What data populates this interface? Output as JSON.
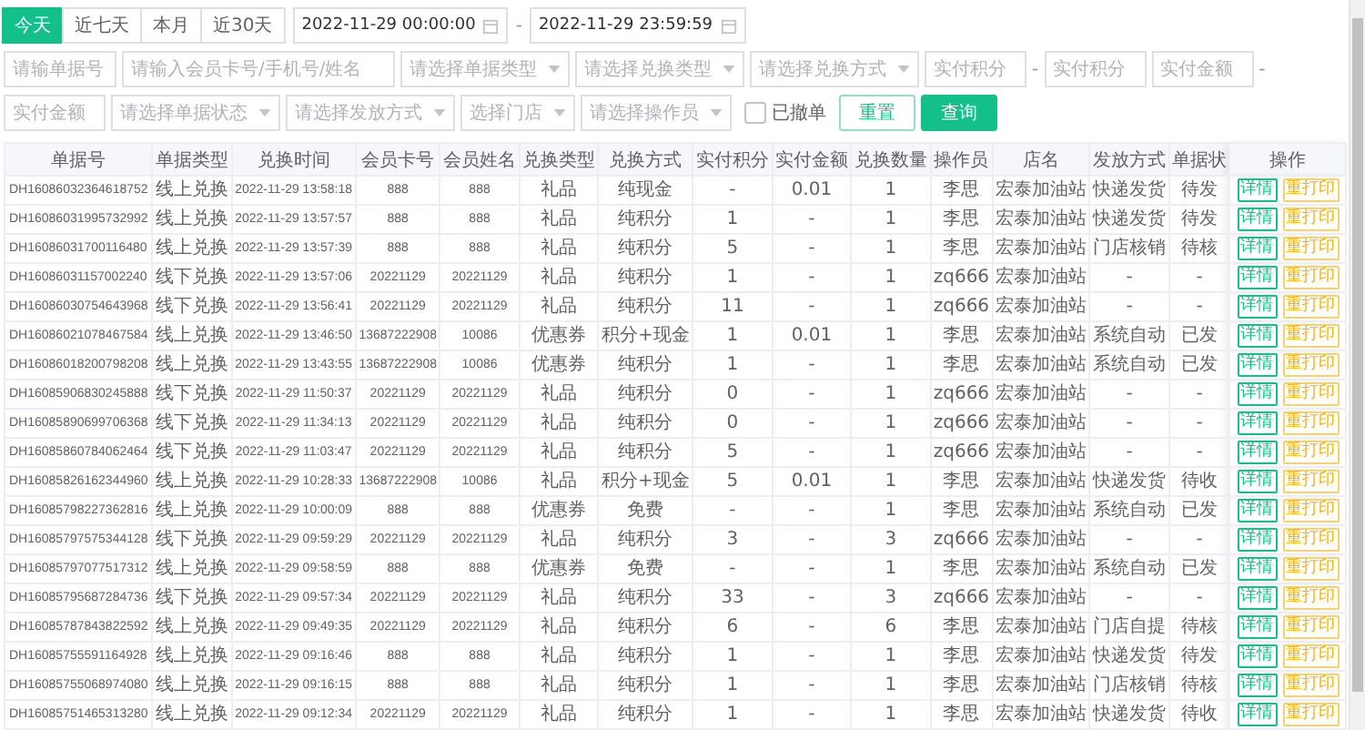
{
  "quick_ranges": [
    {
      "label": "今天",
      "selected": true
    },
    {
      "label": "近七天",
      "selected": false
    },
    {
      "label": "本月",
      "selected": false
    },
    {
      "label": "近30天",
      "selected": false
    }
  ],
  "date_range": {
    "start": "2022-11-29 00:00:00",
    "separator": "-",
    "end": "2022-11-29 23:59:59"
  },
  "filters": [
    {
      "kind": "input",
      "placeholder": "请输单据号"
    },
    {
      "kind": "input",
      "placeholder": "请输入会员卡号/手机号/姓名"
    },
    {
      "kind": "select",
      "placeholder": "请选择单据类型"
    },
    {
      "kind": "select",
      "placeholder": "请选择兑换类型"
    },
    {
      "kind": "select",
      "placeholder": "请选择兑换方式"
    },
    {
      "kind": "input",
      "placeholder": "实付积分"
    },
    {
      "kind": "dash",
      "text": "-"
    },
    {
      "kind": "input",
      "placeholder": "实付积分"
    },
    {
      "kind": "input",
      "placeholder": "实付金额"
    },
    {
      "kind": "dash",
      "text": "-"
    },
    {
      "kind": "input",
      "placeholder": "实付金额"
    },
    {
      "kind": "select",
      "placeholder": "请选择单据状态"
    },
    {
      "kind": "select",
      "placeholder": "请选择发放方式"
    },
    {
      "kind": "select",
      "placeholder": "选择门店"
    },
    {
      "kind": "select",
      "placeholder": "请选择操作员"
    },
    {
      "kind": "checkbox",
      "label": "已撤单",
      "checked": false
    },
    {
      "kind": "outline_button",
      "label": "重置"
    },
    {
      "kind": "primary_button",
      "label": "查询"
    }
  ],
  "table": {
    "columns": [
      {
        "label": "单据号",
        "kind": "code"
      },
      {
        "label": "单据类型",
        "kind": "text"
      },
      {
        "label": "兑换时间",
        "kind": "code"
      },
      {
        "label": "会员卡号",
        "kind": "code"
      },
      {
        "label": "会员姓名",
        "kind": "code"
      },
      {
        "label": "兑换类型",
        "kind": "text"
      },
      {
        "label": "兑换方式",
        "kind": "text"
      },
      {
        "label": "实付积分",
        "kind": "text"
      },
      {
        "label": "实付金额",
        "kind": "text"
      },
      {
        "label": "兑换数量",
        "kind": "text"
      },
      {
        "label": "操作员",
        "kind": "text"
      },
      {
        "label": "店名",
        "kind": "text"
      },
      {
        "label": "发放方式",
        "kind": "text"
      },
      {
        "label": "单据状",
        "kind": "cut"
      },
      {
        "label": "操作",
        "kind": "actions"
      }
    ],
    "rows": [
      {
        "cells": [
          "DH16086032364618752",
          "线上兑换",
          "2022-11-29 13:58:18",
          "888",
          "888",
          "礼品",
          "纯现金",
          "-",
          "0.01",
          "1",
          "李思",
          "宏泰加油站",
          "快递发货",
          "待发"
        ],
        "actions": [
          {
            "label": "详情",
            "kind": "detail"
          },
          {
            "label": "重打印",
            "kind": "reprint"
          }
        ]
      },
      {
        "cells": [
          "DH16086031995732992",
          "线上兑换",
          "2022-11-29 13:57:57",
          "888",
          "888",
          "礼品",
          "纯积分",
          "1",
          "-",
          "1",
          "李思",
          "宏泰加油站",
          "快递发货",
          "待发"
        ],
        "actions": [
          {
            "label": "详情",
            "kind": "detail"
          },
          {
            "label": "重打印",
            "kind": "reprint"
          }
        ]
      },
      {
        "cells": [
          "DH16086031700116480",
          "线上兑换",
          "2022-11-29 13:57:39",
          "888",
          "888",
          "礼品",
          "纯积分",
          "5",
          "-",
          "1",
          "李思",
          "宏泰加油站",
          "门店核销",
          "待核"
        ],
        "actions": [
          {
            "label": "详情",
            "kind": "detail"
          },
          {
            "label": "重打印",
            "kind": "reprint"
          }
        ]
      },
      {
        "cells": [
          "DH16086031157002240",
          "线下兑换",
          "2022-11-29 13:57:06",
          "20221129",
          "20221129",
          "礼品",
          "纯积分",
          "1",
          "-",
          "1",
          "zq666",
          "宏泰加油站",
          "-",
          "-"
        ],
        "actions": [
          {
            "label": "详情",
            "kind": "detail"
          },
          {
            "label": "重打印",
            "kind": "reprint"
          }
        ]
      },
      {
        "cells": [
          "DH16086030754643968",
          "线下兑换",
          "2022-11-29 13:56:41",
          "20221129",
          "20221129",
          "礼品",
          "纯积分",
          "11",
          "-",
          "1",
          "zq666",
          "宏泰加油站",
          "-",
          "-"
        ],
        "actions": [
          {
            "label": "详情",
            "kind": "detail"
          },
          {
            "label": "重打印",
            "kind": "reprint"
          }
        ]
      },
      {
        "cells": [
          "DH16086021078467584",
          "线上兑换",
          "2022-11-29 13:46:50",
          "13687222908",
          "10086",
          "优惠券",
          "积分+现金",
          "1",
          "0.01",
          "1",
          "李思",
          "宏泰加油站",
          "系统自动",
          "已发"
        ],
        "actions": [
          {
            "label": "详情",
            "kind": "detail"
          },
          {
            "label": "重打印",
            "kind": "reprint"
          }
        ]
      },
      {
        "cells": [
          "DH16086018200798208",
          "线上兑换",
          "2022-11-29 13:43:55",
          "13687222908",
          "10086",
          "优惠券",
          "纯积分",
          "1",
          "-",
          "1",
          "李思",
          "宏泰加油站",
          "系统自动",
          "已发"
        ],
        "actions": [
          {
            "label": "详情",
            "kind": "detail"
          },
          {
            "label": "重打印",
            "kind": "reprint"
          }
        ]
      },
      {
        "cells": [
          "DH16085906830245888",
          "线下兑换",
          "2022-11-29 11:50:37",
          "20221129",
          "20221129",
          "礼品",
          "纯积分",
          "0",
          "-",
          "1",
          "zq666",
          "宏泰加油站",
          "-",
          "-"
        ],
        "actions": [
          {
            "label": "详情",
            "kind": "detail"
          },
          {
            "label": "重打印",
            "kind": "reprint"
          }
        ]
      },
      {
        "cells": [
          "DH16085890699706368",
          "线下兑换",
          "2022-11-29 11:34:13",
          "20221129",
          "20221129",
          "礼品",
          "纯积分",
          "0",
          "-",
          "1",
          "zq666",
          "宏泰加油站",
          "-",
          "-"
        ],
        "actions": [
          {
            "label": "详情",
            "kind": "detail"
          },
          {
            "label": "重打印",
            "kind": "reprint"
          }
        ]
      },
      {
        "cells": [
          "DH16085860784062464",
          "线下兑换",
          "2022-11-29 11:03:47",
          "20221129",
          "20221129",
          "礼品",
          "纯积分",
          "5",
          "-",
          "1",
          "zq666",
          "宏泰加油站",
          "-",
          "-"
        ],
        "actions": [
          {
            "label": "详情",
            "kind": "detail"
          },
          {
            "label": "重打印",
            "kind": "reprint"
          }
        ]
      },
      {
        "cells": [
          "DH16085826162344960",
          "线上兑换",
          "2022-11-29 10:28:33",
          "13687222908",
          "10086",
          "礼品",
          "积分+现金",
          "5",
          "0.01",
          "1",
          "李思",
          "宏泰加油站",
          "快递发货",
          "待收"
        ],
        "actions": [
          {
            "label": "详情",
            "kind": "detail"
          },
          {
            "label": "重打印",
            "kind": "reprint"
          }
        ]
      },
      {
        "cells": [
          "DH16085798227362816",
          "线上兑换",
          "2022-11-29 10:00:09",
          "888",
          "888",
          "优惠券",
          "免费",
          "-",
          "-",
          "1",
          "李思",
          "宏泰加油站",
          "系统自动",
          "已发"
        ],
        "actions": [
          {
            "label": "详情",
            "kind": "detail"
          },
          {
            "label": "重打印",
            "kind": "reprint"
          }
        ]
      },
      {
        "cells": [
          "DH16085797575344128",
          "线下兑换",
          "2022-11-29 09:59:29",
          "20221129",
          "20221129",
          "礼品",
          "纯积分",
          "3",
          "-",
          "3",
          "zq666",
          "宏泰加油站",
          "-",
          "-"
        ],
        "actions": [
          {
            "label": "详情",
            "kind": "detail"
          },
          {
            "label": "重打印",
            "kind": "reprint"
          }
        ]
      },
      {
        "cells": [
          "DH16085797077517312",
          "线上兑换",
          "2022-11-29 09:58:59",
          "888",
          "888",
          "优惠券",
          "免费",
          "-",
          "-",
          "1",
          "李思",
          "宏泰加油站",
          "系统自动",
          "已发"
        ],
        "actions": [
          {
            "label": "详情",
            "kind": "detail"
          },
          {
            "label": "重打印",
            "kind": "reprint"
          }
        ]
      },
      {
        "cells": [
          "DH16085795687284736",
          "线下兑换",
          "2022-11-29 09:57:34",
          "20221129",
          "20221129",
          "礼品",
          "纯积分",
          "33",
          "-",
          "3",
          "zq666",
          "宏泰加油站",
          "-",
          "-"
        ],
        "actions": [
          {
            "label": "详情",
            "kind": "detail"
          },
          {
            "label": "重打印",
            "kind": "reprint"
          }
        ]
      },
      {
        "cells": [
          "DH16085787843822592",
          "线上兑换",
          "2022-11-29 09:49:35",
          "20221129",
          "20221129",
          "礼品",
          "纯积分",
          "6",
          "-",
          "6",
          "李思",
          "宏泰加油站",
          "门店自提",
          "待核"
        ],
        "actions": [
          {
            "label": "详情",
            "kind": "detail"
          },
          {
            "label": "重打印",
            "kind": "reprint"
          }
        ]
      },
      {
        "cells": [
          "DH16085755591164928",
          "线上兑换",
          "2022-11-29 09:16:46",
          "888",
          "888",
          "礼品",
          "纯积分",
          "1",
          "-",
          "1",
          "李思",
          "宏泰加油站",
          "快递发货",
          "待发"
        ],
        "actions": [
          {
            "label": "详情",
            "kind": "detail"
          },
          {
            "label": "重打印",
            "kind": "reprint"
          }
        ]
      },
      {
        "cells": [
          "DH16085755068974080",
          "线上兑换",
          "2022-11-29 09:16:15",
          "888",
          "888",
          "礼品",
          "纯积分",
          "1",
          "-",
          "1",
          "李思",
          "宏泰加油站",
          "门店核销",
          "待核"
        ],
        "actions": [
          {
            "label": "详情",
            "kind": "detail"
          },
          {
            "label": "重打印",
            "kind": "reprint"
          }
        ]
      },
      {
        "cells": [
          "DH16085751465313280",
          "线上兑换",
          "2022-11-29 09:12:34",
          "20221129",
          "20221129",
          "礼品",
          "纯积分",
          "1",
          "-",
          "1",
          "李思",
          "宏泰加油站",
          "快递发货",
          "待收"
        ],
        "actions": [
          {
            "label": "详情",
            "kind": "detail"
          },
          {
            "label": "重打印",
            "kind": "reprint"
          }
        ]
      }
    ]
  }
}
